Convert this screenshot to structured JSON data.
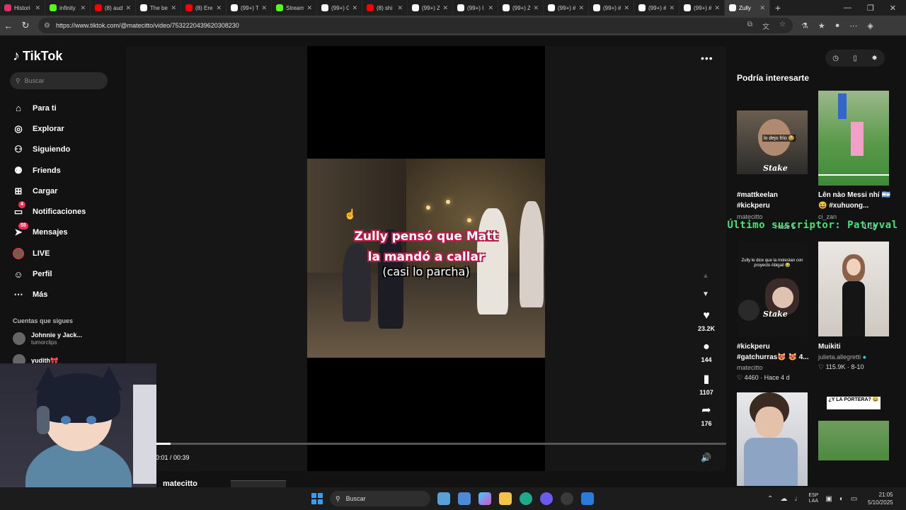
{
  "browser": {
    "tabs": [
      {
        "label": "Histori",
        "color": "#e1306c"
      },
      {
        "label": "infinity",
        "color": "#53fc18"
      },
      {
        "label": "(8) aud",
        "color": "#ff0000"
      },
      {
        "label": "The be",
        "color": "#ffffff"
      },
      {
        "label": "(8) Ere",
        "color": "#ff0000"
      },
      {
        "label": "(99+) T",
        "color": "#ffffff"
      },
      {
        "label": "Stream",
        "color": "#53fc18"
      },
      {
        "label": "(99+) G",
        "color": "#ffffff"
      },
      {
        "label": "(8) shi",
        "color": "#ff0000"
      },
      {
        "label": "(99+) Z",
        "color": "#ffffff"
      },
      {
        "label": "(99+) I",
        "color": "#ffffff"
      },
      {
        "label": "(99+) Z",
        "color": "#ffffff"
      },
      {
        "label": "(99+) #",
        "color": "#ffffff"
      },
      {
        "label": "(99+) #",
        "color": "#ffffff"
      },
      {
        "label": "(99+) #",
        "color": "#ffffff"
      },
      {
        "label": "(99+) #",
        "color": "#ffffff"
      },
      {
        "label": "Zully",
        "color": "#ffffff"
      }
    ],
    "url": "https://www.tiktok.com/@matecitto/video/7532220439620308230"
  },
  "sidebar": {
    "logo": "TikTok",
    "search_placeholder": "Buscar",
    "menu": [
      {
        "label": "Para ti",
        "icon": "home-icon",
        "glyph": "⌂"
      },
      {
        "label": "Explorar",
        "icon": "compass-icon",
        "glyph": "◎"
      },
      {
        "label": "Siguiendo",
        "icon": "following-icon",
        "glyph": "⚇"
      },
      {
        "label": "Friends",
        "icon": "friends-icon",
        "glyph": "⚉"
      },
      {
        "label": "Cargar",
        "icon": "upload-icon",
        "glyph": "⊞"
      },
      {
        "label": "Notificaciones",
        "icon": "inbox-icon",
        "glyph": "▭",
        "badge": "4"
      },
      {
        "label": "Mensajes",
        "icon": "messages-icon",
        "glyph": "➤",
        "badge": "55"
      },
      {
        "label": "LIVE",
        "icon": "live-avatar",
        "glyph": ""
      },
      {
        "label": "Perfil",
        "icon": "profile-icon",
        "glyph": "☺"
      },
      {
        "label": "Más",
        "icon": "more-icon",
        "glyph": "⋯"
      }
    ],
    "following_title": "Cuentas que sigues",
    "following": [
      {
        "name": "Johnnie y Jack...",
        "sub": "tumorclips"
      },
      {
        "name": "yudith🎀",
        "sub": ""
      }
    ]
  },
  "video": {
    "caption_line1": "Zully pensó que Matt",
    "caption_line2": "la mandó a callar",
    "caption_line3": "(casi lo parcha)",
    "time": "0:01 / 00:39",
    "progress": 0.026,
    "author": "matecitto",
    "actions": [
      {
        "name": "like",
        "glyph": "♥",
        "count": "23.2K"
      },
      {
        "name": "comment",
        "glyph": "●",
        "count": "144"
      },
      {
        "name": "save",
        "glyph": "▮",
        "count": "1107"
      },
      {
        "name": "share",
        "glyph": "➦",
        "count": "176"
      }
    ]
  },
  "suggestions": {
    "title": "Podría interesarte",
    "overlay": "Último suscriptor: Patryval",
    "cards": [
      {
        "title": "#mattkeelan #kickperu",
        "user": "matecitto",
        "meta": "Hace 1",
        "thumb_text": "lo dejo frío 😂",
        "brand": "Stake"
      },
      {
        "title": "Lên nào Messi nhí 🇦🇷 😆 #xuhuong...",
        "user": "ci_zan",
        "meta": "1-18",
        "thumb_text": "",
        "brand": ""
      },
      {
        "title": "#kickperu #gatchurras😻 😻 4...",
        "user": "matecitto",
        "meta": "4460 · Hace 4 d",
        "thumb_text": "Zully le dice que la molestan con proyecto Abigail 😂",
        "brand": "Stake"
      },
      {
        "title": "Muikiti",
        "user": "julieta.allegretti",
        "meta": "115.9K · 8-10",
        "thumb_text": "",
        "brand": ""
      },
      {
        "title": "",
        "user": "",
        "meta": "",
        "thumb_text": "",
        "brand": ""
      },
      {
        "title": "",
        "user": "",
        "meta": "",
        "thumb_text": "¿Y LA PORTERA? 😂",
        "brand": ""
      }
    ]
  },
  "taskbar": {
    "search": "Buscar",
    "lang_top": "ESP",
    "lang_bottom": "LAA",
    "time": "21:05",
    "date": "5/10/2025"
  }
}
